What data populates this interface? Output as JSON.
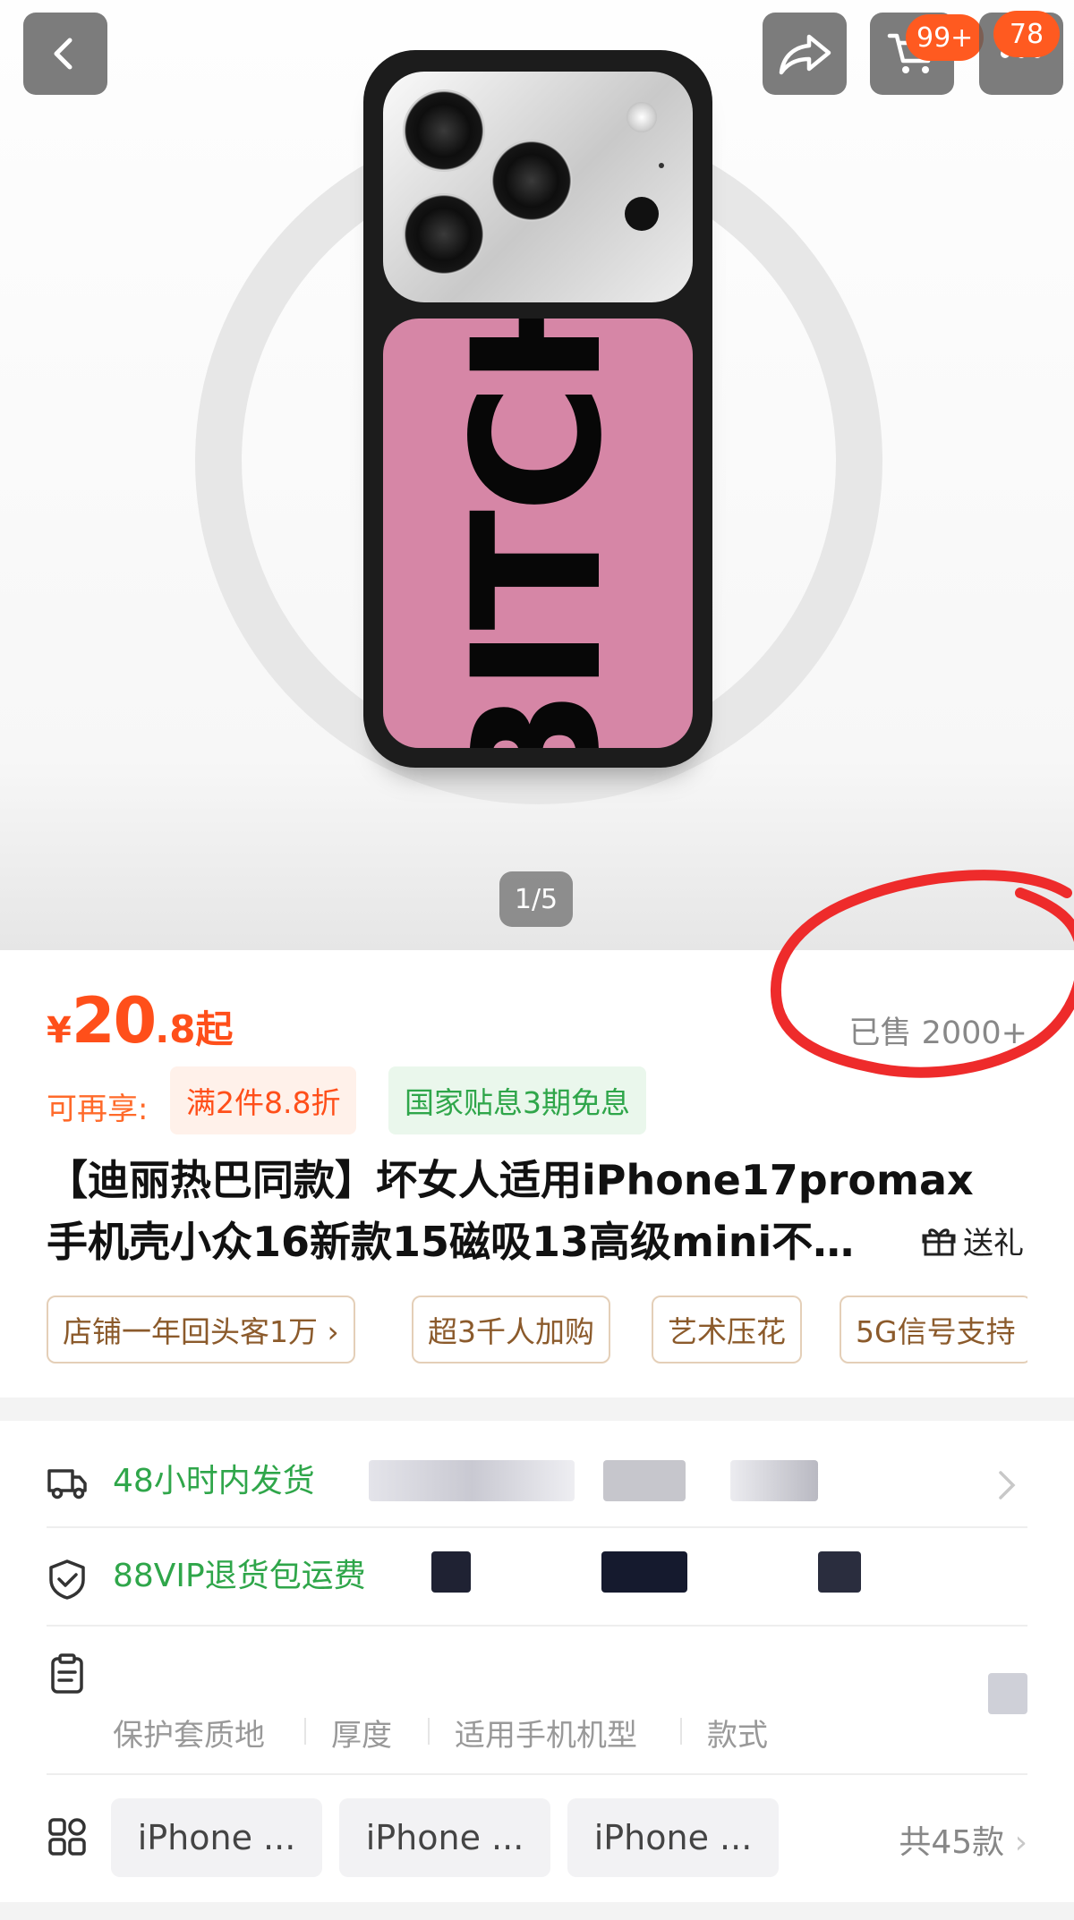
{
  "gallery": {
    "product_print": "BITCH",
    "page_indicator": "1/5"
  },
  "nav": {
    "cart_badge": "99+",
    "messages_badge": "78"
  },
  "pricing": {
    "currency": "¥",
    "price_main": "20",
    "price_decimal": ".8",
    "price_suffix": "起",
    "sold": "已售 2000+"
  },
  "promo": {
    "lead": "可再享:",
    "discount": "满2件8.8折",
    "installment": "国家贴息3期免息"
  },
  "product": {
    "title_line1": "【迪丽热巴同款】坏女人适用iPhone17promax",
    "title_line2": "手机壳小众16新款15磁吸13高级mini不…",
    "gift_label": "送礼"
  },
  "tags": [
    "店铺一年回头客1万 ›",
    "超3千人加购",
    "艺术压花",
    "5G信号支持"
  ],
  "service": {
    "shipping": "48小时内发货",
    "returns": "88VIP退货包运费"
  },
  "params": {
    "names": [
      "保护套质地",
      "厚度",
      "适用手机机型",
      "款式"
    ]
  },
  "sku": {
    "chips": [
      "iPhone ...",
      "iPhone ...",
      "iPhone ..."
    ],
    "total": "共45款"
  },
  "colors": {
    "accent": "#ff4f1a",
    "green": "#2fa64a",
    "case_pink": "#d686a6",
    "annotation": "#ee2b2b"
  },
  "icons": [
    "back-icon",
    "share-icon",
    "cart-icon",
    "more-icon",
    "gift-icon",
    "truck-icon",
    "shield-check-icon",
    "clipboard-icon",
    "grid-icon",
    "chevron-right-icon"
  ]
}
